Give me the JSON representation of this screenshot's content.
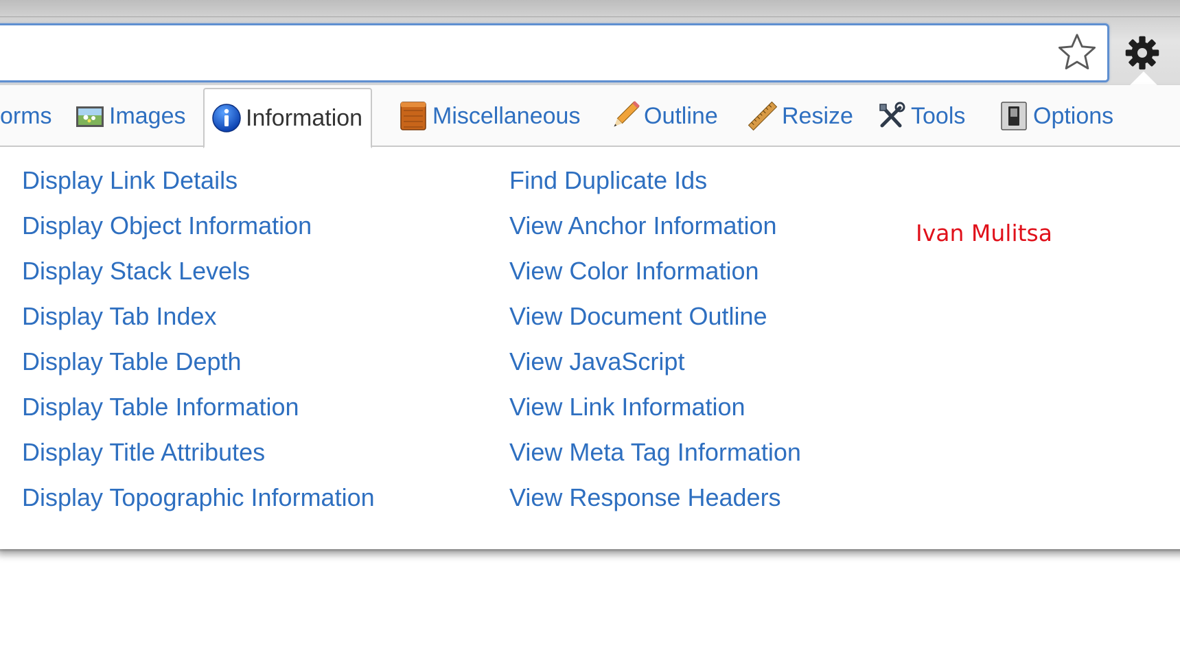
{
  "toolbar": {
    "star_icon": "star-outline-icon",
    "gear_icon": "gear-icon"
  },
  "tabs": [
    {
      "label": "orms",
      "icon": "forms-icon"
    },
    {
      "label": "Images",
      "icon": "image-icon"
    },
    {
      "label": "Information",
      "icon": "info-icon",
      "active": true
    },
    {
      "label": "Miscellaneous",
      "icon": "box-icon"
    },
    {
      "label": "Outline",
      "icon": "pencil-icon"
    },
    {
      "label": "Resize",
      "icon": "ruler-icon"
    },
    {
      "label": "Tools",
      "icon": "tools-icon"
    },
    {
      "label": "Options",
      "icon": "switch-icon"
    }
  ],
  "links_left": [
    "Display Link Details",
    "Display Object Information",
    "Display Stack Levels",
    "Display Tab Index",
    "Display Table Depth",
    "Display Table Information",
    "Display Title Attributes",
    "Display Topographic Information"
  ],
  "links_right": [
    "Find Duplicate Ids",
    "View Anchor Information",
    "View Color Information",
    "View Document Outline",
    "View JavaScript",
    "View Link Information",
    "View Meta Tag Information",
    "View Response Headers"
  ],
  "annotation": "Ivan Mulitsa",
  "colors": {
    "link": "#2e6fc0",
    "active_tab_text": "#333333",
    "annotation": "#e0101a",
    "url_border": "#5f8fd0"
  }
}
